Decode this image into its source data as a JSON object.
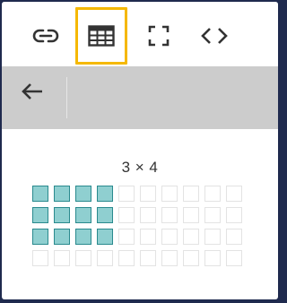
{
  "toolbar": {
    "buttons": [
      {
        "name": "link-button",
        "icon": "link-icon"
      },
      {
        "name": "table-button",
        "icon": "table-icon",
        "active": true
      },
      {
        "name": "fullscreen-button",
        "icon": "fullscreen-icon"
      },
      {
        "name": "code-button",
        "icon": "code-icon"
      }
    ],
    "active_color": "#f5b800"
  },
  "subbar": {
    "back_icon": "arrow-left-icon"
  },
  "table_picker": {
    "size_label": "3 × 4",
    "rows": 4,
    "cols": 10,
    "selected_rows": 3,
    "selected_cols": 4,
    "selected_fill": "#8fcfd0",
    "selected_border": "#2a8a8e"
  }
}
